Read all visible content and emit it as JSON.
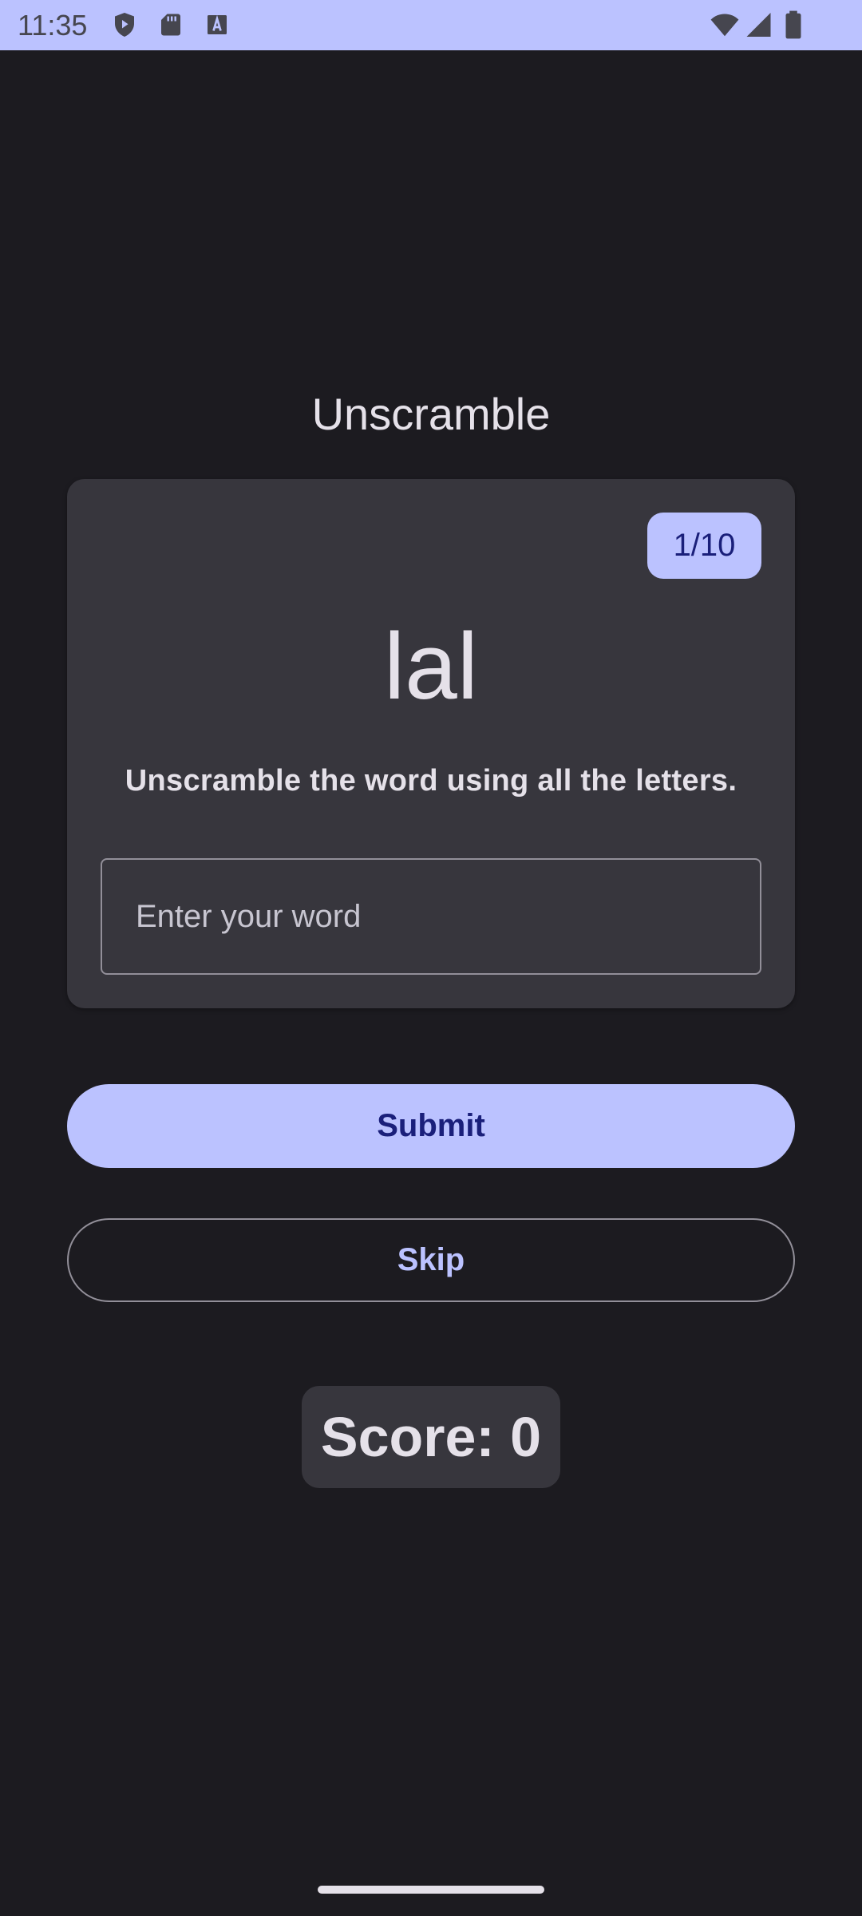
{
  "status_bar": {
    "time": "11:35",
    "left_icons": [
      "shield-play-icon",
      "sd-card-icon",
      "font-a-icon"
    ],
    "right_icons": [
      "wifi-icon",
      "cellular-signal-icon",
      "battery-icon"
    ],
    "background_color": "#bbc2ff"
  },
  "title": "Unscramble",
  "card": {
    "word_count": "1/10",
    "scrambled_word": "lal",
    "instructions": "Unscramble the word using all the letters.",
    "input_placeholder": "Enter your word",
    "input_value": ""
  },
  "buttons": {
    "submit_label": "Submit",
    "skip_label": "Skip"
  },
  "score_text": "Score: 0",
  "colors": {
    "background": "#1c1b20",
    "surface": "#37363d",
    "primary": "#bbc2ff",
    "on_primary": "#1a1f7a",
    "on_surface": "#e5e1e9",
    "outline": "#928f99"
  }
}
